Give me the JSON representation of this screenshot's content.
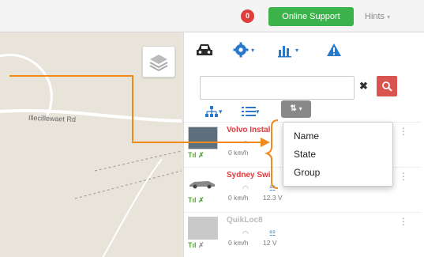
{
  "topbar": {
    "badge_count": "0",
    "support_label": "Online Support",
    "hints_label": "Hints"
  },
  "map": {
    "road_label": "Illecillewaet Rd"
  },
  "panel": {
    "tabs": [
      {
        "icon": "car-icon"
      },
      {
        "icon": "gear-icon"
      },
      {
        "icon": "bar-chart-icon"
      },
      {
        "icon": "alert-icon"
      }
    ],
    "search": {
      "value": "",
      "placeholder": ""
    },
    "sort_menu": [
      "Name",
      "State",
      "Group"
    ],
    "vehicles": [
      {
        "name": "Volvo Instal",
        "name_color": "#e0393e",
        "speed": "0 km/h",
        "voltage": ""
      },
      {
        "name": "Sydney Swi",
        "name_color": "#e0393e",
        "speed": "0 km/h",
        "voltage": "12.3 V"
      },
      {
        "name": "QuikLoc8",
        "name_color": "#bbbbbb",
        "speed": "0 km/h",
        "voltage": "12 V"
      }
    ]
  },
  "colors": {
    "support_green": "#3bb34a",
    "badge_red": "#e03d3d",
    "accent_blue": "#2a78c9",
    "annotation_orange": "#f08a1d"
  }
}
